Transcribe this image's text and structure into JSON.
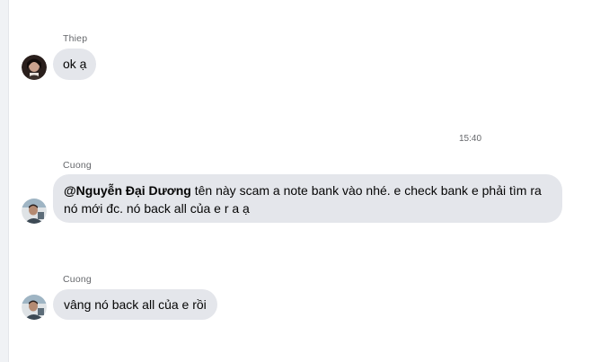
{
  "messages": [
    {
      "sender": "Thiep",
      "text": "ok ạ"
    },
    {
      "sender": "Cuong",
      "mention": "@Nguyễn Đại Dương",
      "text_line1": " tên này scam a note bank vào nhé. e check bank e phải tìm ra",
      "text_line2": "nó mới đc. nó back all của e r a ạ"
    },
    {
      "sender": "Cuong",
      "text": "vâng nó back all của e rồi"
    }
  ],
  "timestamp": "15:40",
  "colors": {
    "bubble": "#e4e6eb",
    "meta_text": "#65676b",
    "rail": "#f0f2f5"
  }
}
